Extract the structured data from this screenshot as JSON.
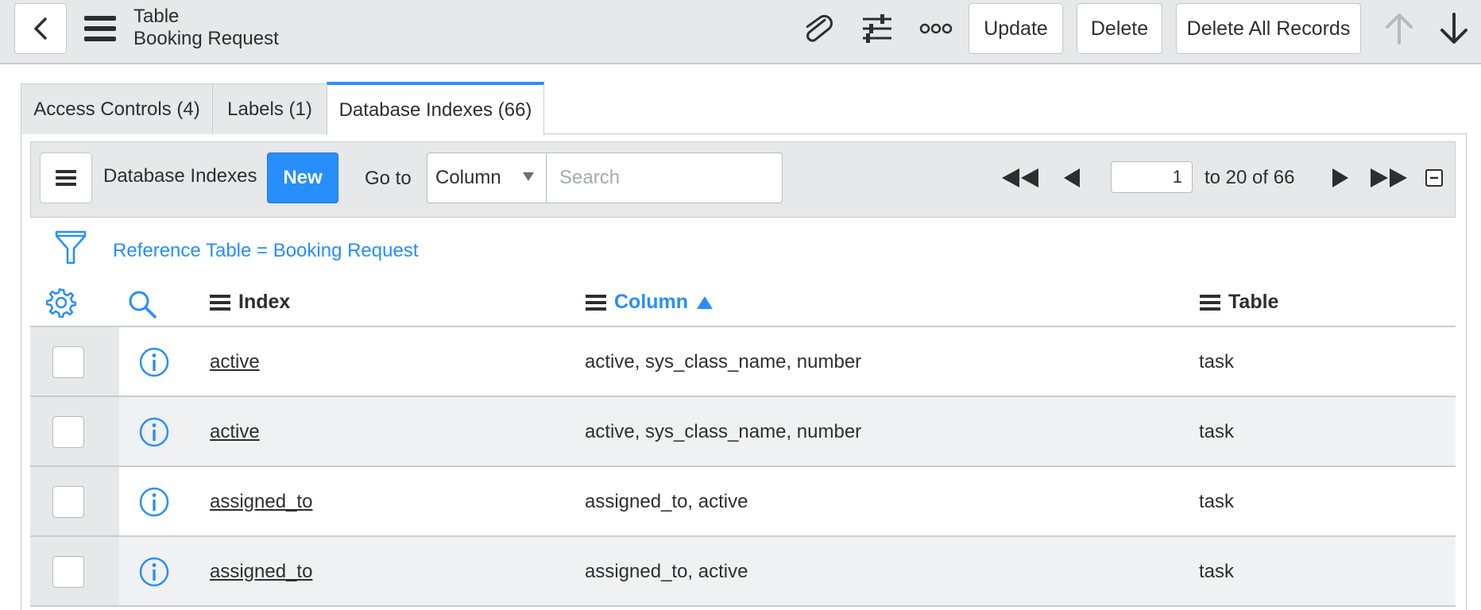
{
  "header": {
    "title": "Table",
    "subtitle": "Booking Request",
    "buttons": {
      "update": "Update",
      "delete": "Delete",
      "delete_all": "Delete All Records"
    },
    "icons": [
      "back-icon",
      "hamburger-icon",
      "paperclip-icon",
      "sliders-icon",
      "more-icon",
      "arrow-up-icon",
      "arrow-down-icon"
    ]
  },
  "tabs": [
    {
      "label": "Access Controls (4)",
      "active": false
    },
    {
      "label": "Labels (1)",
      "active": false
    },
    {
      "label": "Database Indexes (66)",
      "active": true
    }
  ],
  "list": {
    "title": "Database Indexes",
    "new_label": "New",
    "goto_label": "Go to",
    "goto_select": "Column",
    "search_placeholder": "Search",
    "page_value": "1",
    "page_of": "to 20 of 66",
    "filter": "Reference Table = Booking Request",
    "columns": {
      "index": "Index",
      "column": "Column",
      "table": "Table"
    },
    "sort_column": "Column",
    "rows": [
      {
        "index": "active",
        "column": "active, sys_class_name, number",
        "table": "task"
      },
      {
        "index": "active",
        "column": "active, sys_class_name, number",
        "table": "task"
      },
      {
        "index": "assigned_to",
        "column": "assigned_to, active",
        "table": "task"
      },
      {
        "index": "assigned_to",
        "column": "assigned_to, active",
        "table": "task"
      }
    ]
  },
  "colors": {
    "accent": "#278efc",
    "header_bg": "#e6e8ea",
    "border": "#c9ccd0"
  }
}
